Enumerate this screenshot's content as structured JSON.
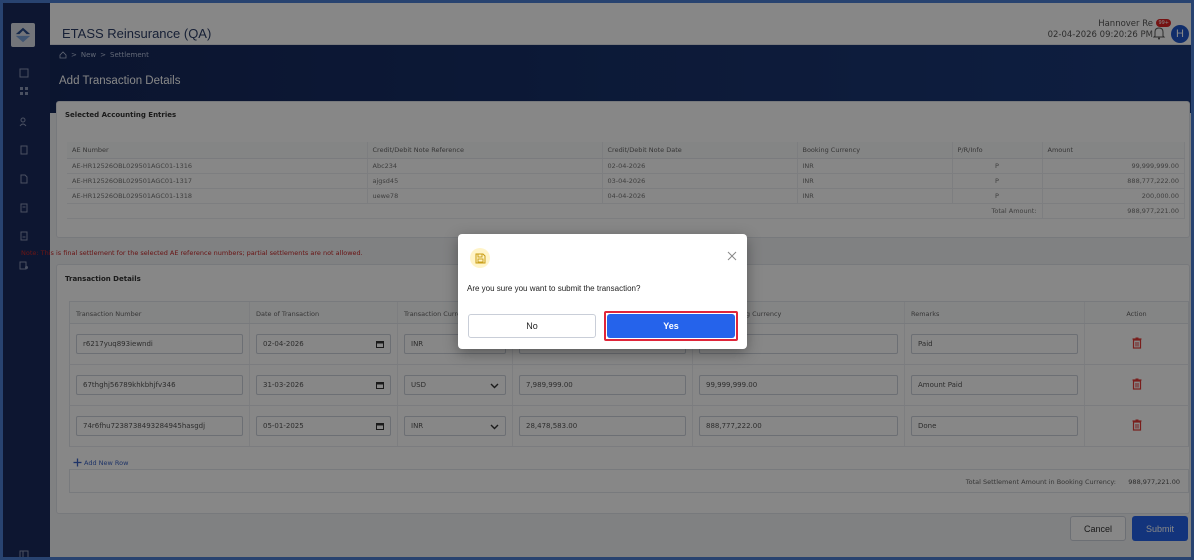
{
  "app": {
    "title": "ETASS Reinsurance (QA)"
  },
  "user": {
    "name": "Hannover Re",
    "datetime": "02-04-2026 09:20:26 PM",
    "avatar_initial": "H",
    "notification_badge": "99+"
  },
  "breadcrumb": {
    "items": [
      "New",
      "Settlement"
    ]
  },
  "page": {
    "title": "Add Transaction Details"
  },
  "accounting": {
    "section_title": "Selected Accounting Entries",
    "columns": [
      "AE Number",
      "Credit/Debit Note Reference",
      "Credit/Debit Note Date",
      "Booking Currency",
      "P/R/Info",
      "Amount"
    ],
    "rows": [
      [
        "AE-HR12526OBL029501AGC01-1316",
        "Abc234",
        "02-04-2026",
        "INR",
        "P",
        "99,999,999.00"
      ],
      [
        "AE-HR12526OBL029501AGC01-1317",
        "ajgsd45",
        "03-04-2026",
        "INR",
        "P",
        "888,777,222.00"
      ],
      [
        "AE-HR12526OBL029501AGC01-1318",
        "uewe78",
        "04-04-2026",
        "INR",
        "P",
        "200,000.00"
      ]
    ],
    "total_label": "Total Amount:",
    "total_value": "988,977,221.00"
  },
  "note": "Note: This is final settlement for the selected AE reference numbers; partial settlements are not allowed.",
  "transactions": {
    "section_title": "Transaction Details",
    "columns": [
      "Transaction Number",
      "Date of Transaction",
      "Transaction Curre",
      "",
      "ount in Booking Currency",
      "Remarks",
      "Action"
    ],
    "rows": [
      {
        "number": "r6217yuq893iewndi",
        "date": "02-04-2026",
        "currency": "INR",
        "amount": "",
        "booking_amount": "",
        "remarks": "Paid"
      },
      {
        "number": "67thghj56789khkbhjfv346",
        "date": "31-03-2026",
        "currency": "USD",
        "amount": "7,989,999.00",
        "booking_amount": "99,999,999.00",
        "remarks": "Amount Paid"
      },
      {
        "number": "74r6fhu7238738493284945hasgdj",
        "date": "05-01-2025",
        "currency": "INR",
        "amount": "28,478,583.00",
        "booking_amount": "888,777,222.00",
        "remarks": "Done"
      }
    ],
    "add_row_label": "Add New Row",
    "total_label": "Total Settlement Amount in Booking Currency:",
    "total_value": "988,977,221.00"
  },
  "actions": {
    "cancel": "Cancel",
    "submit": "Submit"
  },
  "modal": {
    "icon": "save-icon",
    "message": "Are you sure you want to submit the transaction?",
    "no_label": "No",
    "yes_label": "Yes"
  },
  "colors": {
    "primary": "#2563eb",
    "sidebar": "#1a2b5e",
    "highlight": "#e0263a",
    "note": "#c62828"
  }
}
